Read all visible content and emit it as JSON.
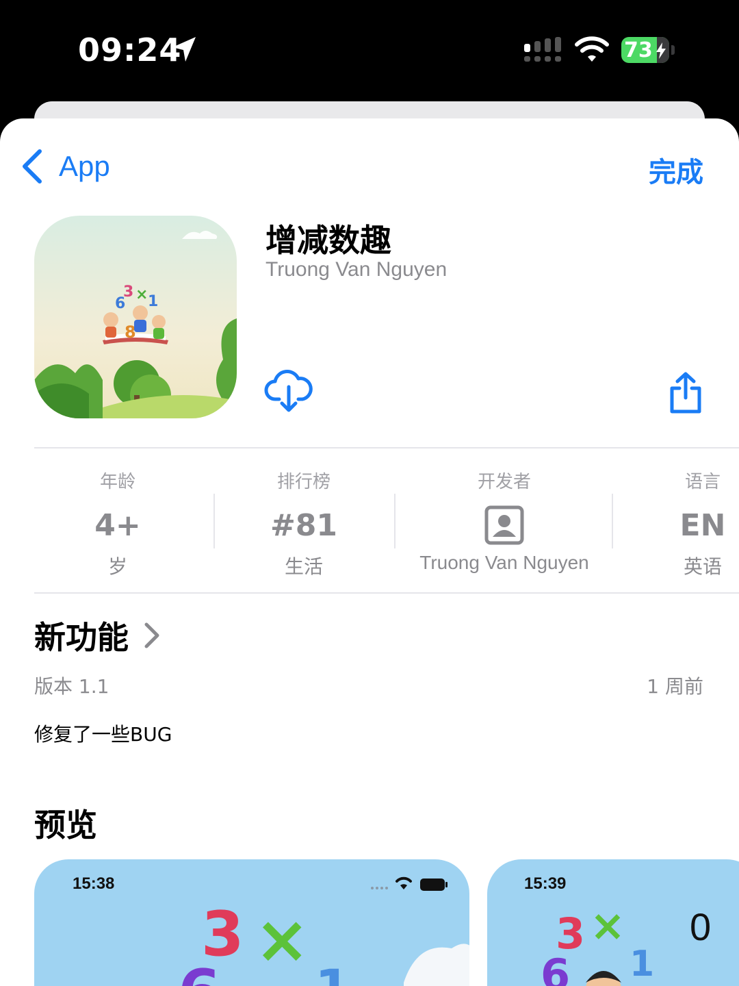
{
  "status_bar": {
    "time": "09:24",
    "battery": "73"
  },
  "nav": {
    "back_label": "App",
    "done_label": "完成"
  },
  "app": {
    "name": "增减数趣",
    "developer": "Truong Van Nguyen"
  },
  "info": {
    "age": {
      "label": "年龄",
      "value": "4+",
      "sub": "岁"
    },
    "chart": {
      "label": "排行榜",
      "value": "#81",
      "sub": "生活"
    },
    "developer": {
      "label": "开发者",
      "sub": "Truong Van Nguyen"
    },
    "language": {
      "label": "语言",
      "value": "EN",
      "sub": "英语"
    }
  },
  "whats_new": {
    "title": "新功能",
    "version": "版本 1.1",
    "date": "1 周前",
    "notes": "修复了一些BUG"
  },
  "preview": {
    "title": "预览",
    "screenshots": [
      {
        "time": "15:38"
      },
      {
        "time": "15:39",
        "score": "0"
      }
    ]
  },
  "colors": {
    "accent": "#1a7cf5",
    "battery": "#4cd964",
    "secondary_text": "#8a8a8e"
  }
}
